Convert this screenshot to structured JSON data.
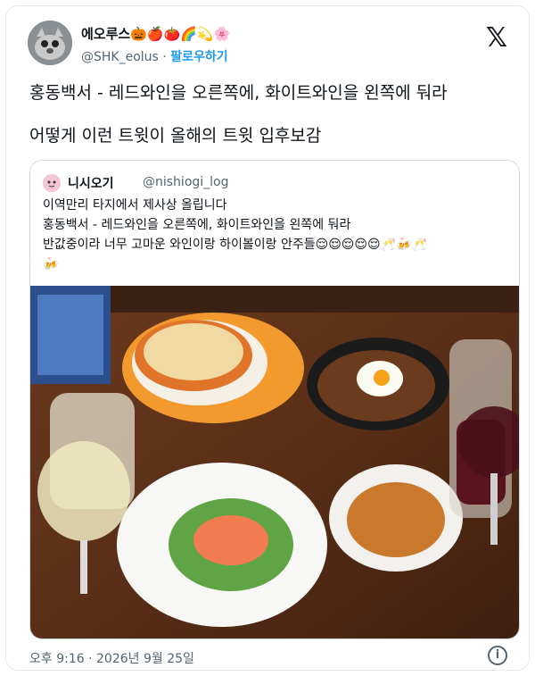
{
  "author": {
    "name": "에오루스🎃🍎🍅🌈💫🌸",
    "handle": "@SHK_eolus",
    "separator": "·",
    "follow_label": "팔로우하기"
  },
  "icons": {
    "logo": "x-logo-icon",
    "info": "info-icon"
  },
  "x_logo_glyph": "𝕏",
  "tweet": {
    "line1": "홍동백서 - 레드와인을 오른쪽에, 화이트와인을 왼쪽에 둬라",
    "line2": "어떻게 이런 트윗이 올해의 트윗 입후보감"
  },
  "quote": {
    "name": "니시오기",
    "handle": "@nishiogi_log",
    "line1": "이역만리 타지에서 제사상 올립니다",
    "line2": "홍동백서 - 레드와인을 오른쪽에, 화이트와인을 왼쪽에 둬라",
    "line3": "반값중이라 너무 고마운 와인이랑 하이볼이랑 안주들😌😌😌😌😌🥂🍻🥂",
    "line4": "🍻"
  },
  "footer": {
    "timestamp": "오후 9:16 · 2026년 9월 25일",
    "info_glyph": "i"
  },
  "colors": {
    "link": "#1d9bf0",
    "muted": "#536471",
    "border": "#cfd9de"
  }
}
